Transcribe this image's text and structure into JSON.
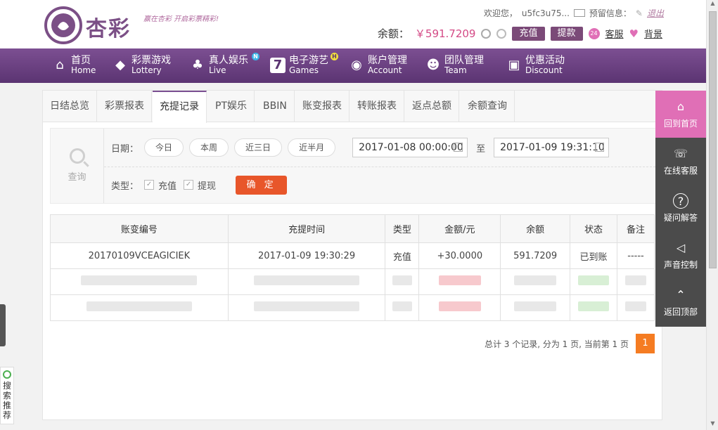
{
  "header": {
    "logo_text": "杏彩",
    "slogan": "赢在杏彩 开启彩票精彩!",
    "welcome": "欢迎您，",
    "username": "u5fc3u75...",
    "message_label": "预留信息：",
    "logout": "退出",
    "balance_label": "余额：",
    "balance_value": "￥591.7209",
    "deposit_btn": "充值",
    "withdraw_btn": "提款",
    "service_link": "客服",
    "background_link": "背景"
  },
  "nav": [
    {
      "icon": "home-icon",
      "glyph": "⌂",
      "cn": "首页",
      "en": "Home"
    },
    {
      "icon": "lottery-icon",
      "glyph": "◆",
      "cn": "彩票游戏",
      "en": "Lottery"
    },
    {
      "icon": "live-icon",
      "glyph": "♣",
      "cn": "真人娱乐",
      "en": "Live",
      "badge": "N"
    },
    {
      "icon": "games-icon",
      "glyph": "7",
      "cn": "电子游艺",
      "en": "Games",
      "badge": "H"
    },
    {
      "icon": "account-icon",
      "glyph": "◉",
      "cn": "账户管理",
      "en": "Account"
    },
    {
      "icon": "team-icon",
      "glyph": "☻",
      "cn": "团队管理",
      "en": "Team"
    },
    {
      "icon": "gift-icon",
      "glyph": "▣",
      "cn": "优惠活动",
      "en": "Discount"
    }
  ],
  "tabs": [
    "日结总览",
    "彩票报表",
    "充提记录",
    "PT娱乐",
    "BBIN",
    "账变报表",
    "转账报表",
    "返点总额",
    "余额查询"
  ],
  "active_tab": "充提记录",
  "search": {
    "icon_label": "查询",
    "date_label": "日期：",
    "quick_dates": [
      "今日",
      "本周",
      "近三日",
      "近半月"
    ],
    "start": "2017-01-08 00:00:00",
    "to": "至",
    "end": "2017-01-09 19:31:10",
    "type_label": "类型：",
    "types": [
      "充值",
      "提现"
    ],
    "confirm": "确 定"
  },
  "table": {
    "headers": [
      "账变编号",
      "充提时间",
      "类型",
      "金额/元",
      "余额",
      "状态",
      "备注"
    ],
    "rows": [
      {
        "id": "20170109VCEAGICIEK",
        "time": "2017-01-09 19:30:29",
        "type": "充值",
        "amount": "+30.0000",
        "balance": "591.7209",
        "status": "已到账",
        "note": "-----"
      }
    ]
  },
  "pager": {
    "summary": "总计 3 个记录, 分为 1 页, 当前第 1 页",
    "current": "1"
  },
  "sidebar": [
    {
      "icon": "home-icon",
      "glyph": "⌂",
      "label": "回到首页"
    },
    {
      "icon": "headset-icon",
      "glyph": "☏",
      "label": "在线客服"
    },
    {
      "icon": "question-icon",
      "glyph": "?",
      "label": "疑问解答"
    },
    {
      "icon": "speaker-icon",
      "glyph": "◁",
      "label": "声音控制"
    },
    {
      "icon": "top-icon",
      "glyph": "⌃",
      "label": "返回顶部"
    }
  ],
  "left_widget": "搜索推荐",
  "colors": {
    "nav": "#6a4282",
    "accent": "#e8562a",
    "sidebar_active": "#e06fb6",
    "balance": "#d44a86"
  }
}
